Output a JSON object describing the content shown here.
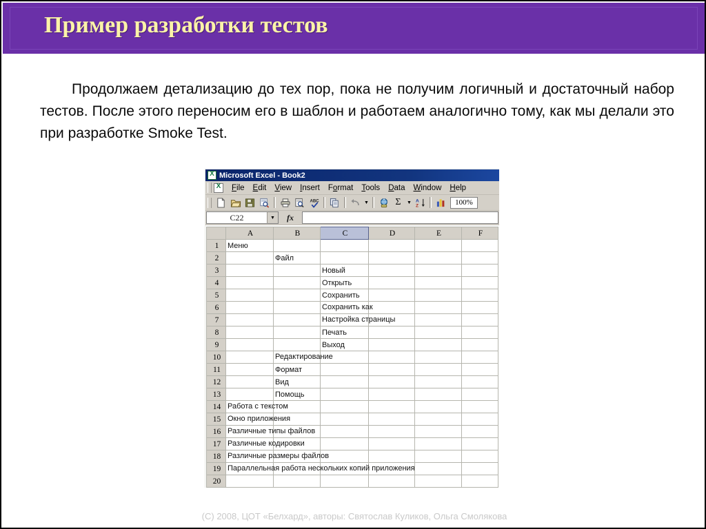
{
  "slide": {
    "title": "Пример разработки тестов",
    "title_color": "#FBF3A8",
    "banner_color": "#6A30A8",
    "body_text": "Продолжаем детализацию до тех пор, пока не получим логичный и достаточный набор тестов. После этого переносим его в шаблон и работаем аналогично тому, как мы делали это при разработке Smoke Test.",
    "footer": "(C) 2008, ЦОТ «Белхард», авторы: Святослав Куликов, Ольга Смолякова"
  },
  "excel": {
    "titlebar": {
      "title": "Microsoft Excel - Book2",
      "icon": "excel-logo-icon",
      "color": "#0a246A"
    },
    "menu": [
      {
        "label": "File",
        "pre": "F",
        "accel": "F",
        "post": "ile"
      },
      {
        "label": "Edit",
        "pre": "E",
        "accel": "E",
        "post": "dit"
      },
      {
        "label": "View",
        "pre": "V",
        "accel": "V",
        "post": "iew"
      },
      {
        "label": "Insert",
        "pre": "I",
        "accel": "I",
        "post": "nsert"
      },
      {
        "label": "Format",
        "pre": "o",
        "accel": "o",
        "post": "rmat"
      },
      {
        "label": "Tools",
        "pre": "T",
        "accel": "T",
        "post": "ools"
      },
      {
        "label": "Data",
        "pre": "D",
        "accel": "D",
        "post": "ata"
      },
      {
        "label": "Window",
        "pre": "W",
        "accel": "W",
        "post": "indow"
      },
      {
        "label": "Help",
        "pre": "H",
        "accel": "H",
        "post": "elp"
      }
    ],
    "toolbar": {
      "buttons": [
        "new-document-icon",
        "open-folder-icon",
        "save-floppy-icon",
        "search-document-icon",
        "print-icon",
        "print-preview-icon",
        "spelling-check-icon",
        "copy-icon",
        "undo-icon",
        "insert-hyperlink-icon",
        "autosum-icon",
        "sort-ascending-icon",
        "chart-wizard-icon"
      ],
      "zoom_value": "100%"
    },
    "formula_bar": {
      "name_box_value": "C22",
      "fx_label": "fx",
      "formula_value": ""
    },
    "grid": {
      "columns": [
        "A",
        "B",
        "C",
        "D",
        "E",
        "F"
      ],
      "selected_column": "C",
      "row_numbers": [
        "1",
        "2",
        "3",
        "4",
        "5",
        "6",
        "7",
        "8",
        "9",
        "10",
        "11",
        "12",
        "13",
        "14",
        "15",
        "16",
        "17",
        "18",
        "19",
        "20"
      ],
      "rows": [
        {
          "n": "1",
          "A": "Меню",
          "B": "",
          "C": ""
        },
        {
          "n": "2",
          "A": "",
          "B": "Файл",
          "C": ""
        },
        {
          "n": "3",
          "A": "",
          "B": "",
          "C": "Новый"
        },
        {
          "n": "4",
          "A": "",
          "B": "",
          "C": "Открыть"
        },
        {
          "n": "5",
          "A": "",
          "B": "",
          "C": "Сохранить"
        },
        {
          "n": "6",
          "A": "",
          "B": "",
          "C": "Сохранить как"
        },
        {
          "n": "7",
          "A": "",
          "B": "",
          "C": "Настройка страницы"
        },
        {
          "n": "8",
          "A": "",
          "B": "",
          "C": "Печать"
        },
        {
          "n": "9",
          "A": "",
          "B": "",
          "C": "Выход"
        },
        {
          "n": "10",
          "A": "",
          "B": "Редактирование",
          "C": ""
        },
        {
          "n": "11",
          "A": "",
          "B": "Формат",
          "C": ""
        },
        {
          "n": "12",
          "A": "",
          "B": "Вид",
          "C": ""
        },
        {
          "n": "13",
          "A": "",
          "B": "Помощь",
          "C": ""
        },
        {
          "n": "14",
          "A": "Работа с текстом",
          "B": "",
          "C": ""
        },
        {
          "n": "15",
          "A": "Окно приложения",
          "B": "",
          "C": ""
        },
        {
          "n": "16",
          "A": "Различные типы файлов",
          "B": "",
          "C": ""
        },
        {
          "n": "17",
          "A": "Различные кодировки",
          "B": "",
          "C": ""
        },
        {
          "n": "18",
          "A": "Различные размеры файлов",
          "B": "",
          "C": ""
        },
        {
          "n": "19",
          "A": "Параллельная работа нескольких копий приложения",
          "B": "",
          "C": ""
        },
        {
          "n": "20",
          "A": "",
          "B": "",
          "C": ""
        }
      ]
    }
  }
}
